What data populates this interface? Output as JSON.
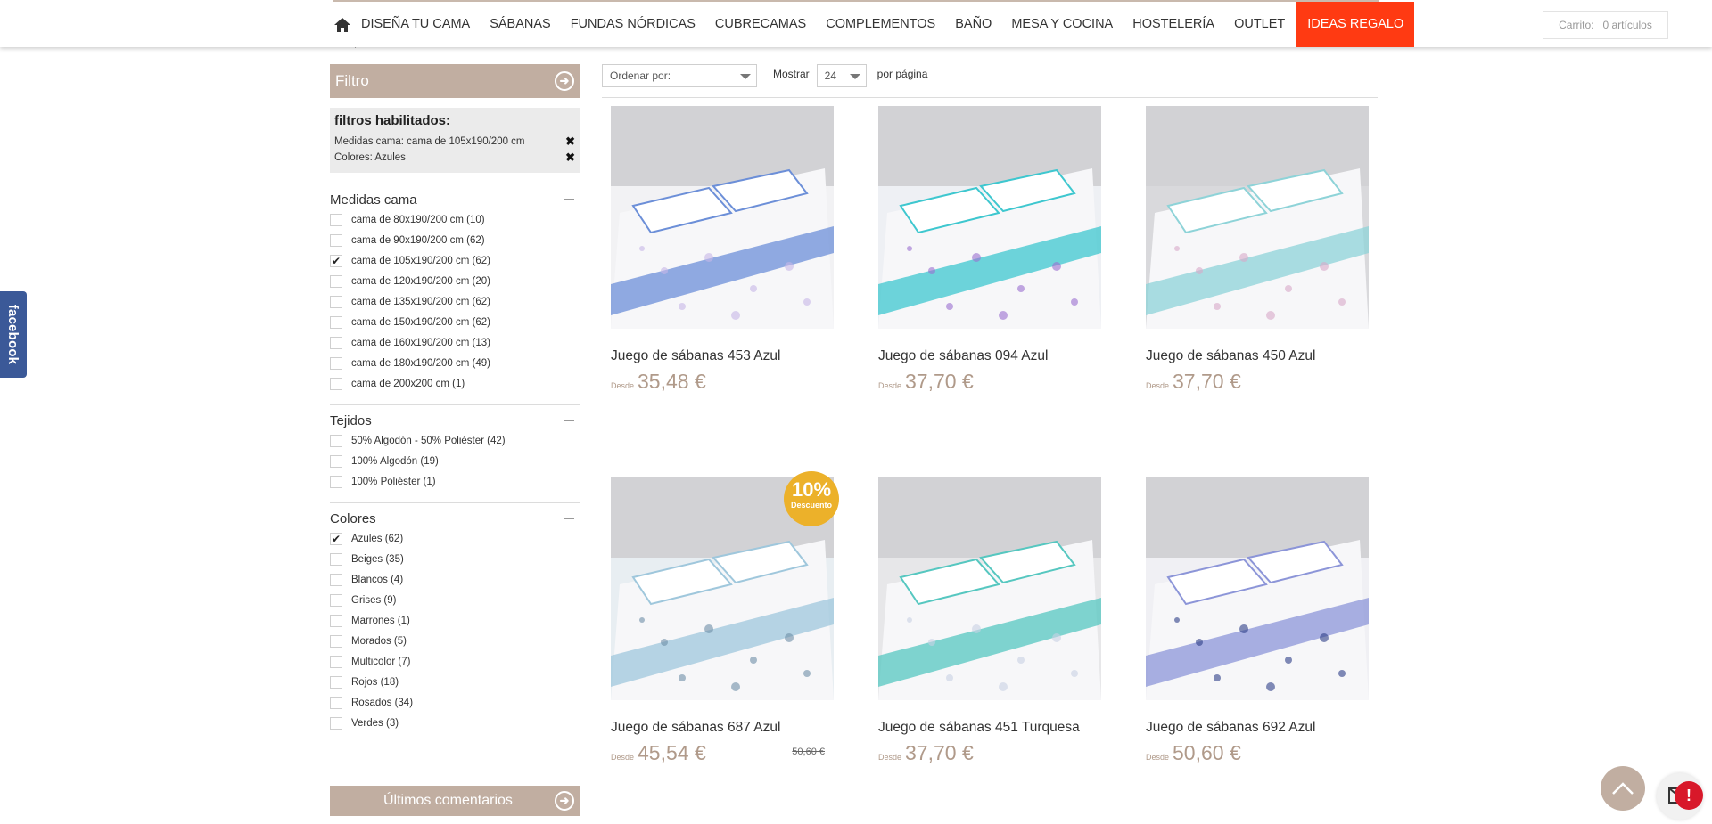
{
  "nav": {
    "items": [
      "DISEÑA TU CAMA",
      "SÁBANAS",
      "FUNDAS NÓRDICAS",
      "CUBRECAMAS",
      "COMPLEMENTOS",
      "BAÑO",
      "MESA Y COCINA",
      "HOSTELERÍA",
      "OUTLET"
    ],
    "highlight": "IDEAS REGALO"
  },
  "cart": {
    "label": "Carrito:",
    "count": "0 artículos"
  },
  "facebook": "facebook",
  "filter": {
    "title": "Filtro",
    "active_title": "filtros habilitados:",
    "active": [
      "Medidas cama: cama de 105x190/200 cm",
      "Colores: Azules"
    ],
    "groups": [
      {
        "title": "Medidas cama",
        "options": [
          {
            "label": "cama de 80x190/200 cm (10)",
            "checked": false
          },
          {
            "label": "cama de 90x190/200 cm (62)",
            "checked": false
          },
          {
            "label": "cama de 105x190/200 cm (62)",
            "checked": true
          },
          {
            "label": "cama de 120x190/200 cm (20)",
            "checked": false
          },
          {
            "label": "cama de 135x190/200 cm (62)",
            "checked": false
          },
          {
            "label": "cama de 150x190/200 cm (62)",
            "checked": false
          },
          {
            "label": "cama de 160x190/200 cm (13)",
            "checked": false
          },
          {
            "label": "cama de 180x190/200 cm (49)",
            "checked": false
          },
          {
            "label": "cama de 200x200 cm (1)",
            "checked": false
          }
        ]
      },
      {
        "title": "Tejidos",
        "options": [
          {
            "label": "50% Algodón - 50% Poliéster (42)",
            "checked": false
          },
          {
            "label": "100% Algodón (19)",
            "checked": false
          },
          {
            "label": "100% Poliéster (1)",
            "checked": false
          }
        ]
      },
      {
        "title": "Colores",
        "options": [
          {
            "label": "Azules (62)",
            "checked": true
          },
          {
            "label": "Beiges (35)",
            "checked": false
          },
          {
            "label": "Blancos (4)",
            "checked": false
          },
          {
            "label": "Grises (9)",
            "checked": false
          },
          {
            "label": "Marrones (1)",
            "checked": false
          },
          {
            "label": "Morados (5)",
            "checked": false
          },
          {
            "label": "Multicolor (7)",
            "checked": false
          },
          {
            "label": "Rojos (18)",
            "checked": false
          },
          {
            "label": "Rosados (34)",
            "checked": false
          },
          {
            "label": "Verdes (3)",
            "checked": false
          }
        ]
      }
    ]
  },
  "comments": {
    "title": "Últimos comentarios"
  },
  "toolbar": {
    "sort_label": "Ordenar por:",
    "show_label": "Mostrar",
    "show_value": "24",
    "per_page": "por página"
  },
  "products": [
    {
      "title": "Juego de sábanas 453 Azul",
      "desde": "Desde",
      "price": "35,48 €",
      "colors": [
        "#f2f2f4",
        "#6c8fd8",
        "#c7b7e8"
      ]
    },
    {
      "title": "Juego de sábanas 094 Azul",
      "desde": "Desde",
      "price": "37,70 €",
      "colors": [
        "#eef0f4",
        "#3ec7cf",
        "#9b6fd1"
      ]
    },
    {
      "title": "Juego de sábanas 450 Azul",
      "desde": "Desde",
      "price": "37,70 €",
      "colors": [
        "#d9d9dc",
        "#8ed3d8",
        "#d9a9c9"
      ]
    },
    {
      "title": "Juego de sábanas 687 Azul",
      "desde": "Desde",
      "price": "45,54 €",
      "old_price": "50,60 €",
      "badge_num": "10%",
      "badge_label": "Descuento",
      "colors": [
        "#e8eef2",
        "#9fc7dc",
        "#6f8fa8"
      ]
    },
    {
      "title": "Juego de sábanas 451 Turquesa",
      "desde": "Desde",
      "price": "37,70 €",
      "colors": [
        "#e7e7e9",
        "#56c7c0",
        "#c9d2e5"
      ]
    },
    {
      "title": "Juego de sábanas 692 Azul",
      "desde": "Desde",
      "price": "50,60 €",
      "colors": [
        "#f0f0f4",
        "#8c95d8",
        "#2e3f88"
      ]
    }
  ]
}
